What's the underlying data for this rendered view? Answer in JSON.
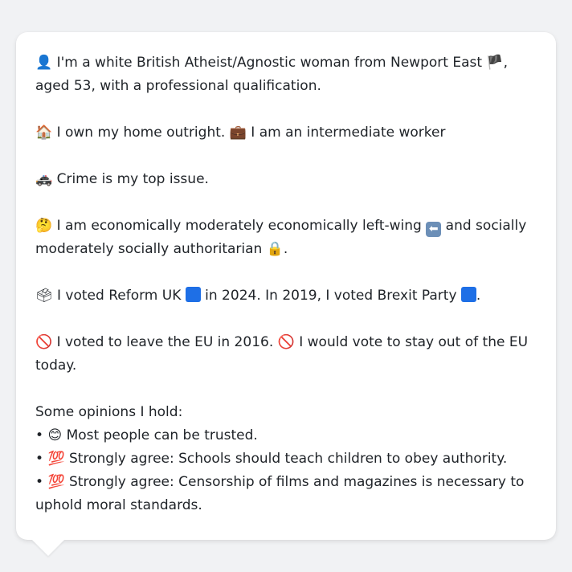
{
  "persona": {
    "intro": {
      "emoji": "👤",
      "text_a": "I'm a white British Atheist/Agnostic woman from Newport East",
      "flag_emoji": "🏴",
      "text_b": ", aged 53, with a professional qualification."
    },
    "home": {
      "emoji_house": "🏠",
      "text_a": "I own my home outright.",
      "emoji_briefcase": "💼",
      "text_b": "I am an intermediate worker"
    },
    "issue": {
      "emoji": "🚓",
      "text": "Crime is my top issue."
    },
    "politics": {
      "emoji_think": "🤔",
      "text_a": "I am economically moderately economically left-wing",
      "emoji_left": "⬅",
      "text_b": "and socially moderately socially authoritarian",
      "emoji_lock": "🔒",
      "text_c": "."
    },
    "vote": {
      "emoji_ballot": "🗳",
      "text_a": "I voted Reform UK",
      "text_b": "in 2024. In 2019, I voted Brexit Party",
      "text_c": "."
    },
    "eu": {
      "emoji_no": "🚫",
      "text_a": "I voted to leave the EU in 2016.",
      "text_b": "I would vote to stay out of the EU today."
    },
    "opinions": {
      "heading": "Some opinions I hold:",
      "bullet": "•",
      "items": [
        {
          "emoji": "😊",
          "text": "Most people can be trusted."
        },
        {
          "emoji": "💯",
          "text": "Strongly agree: Schools should teach children to obey authority."
        },
        {
          "emoji": "💯",
          "text": "Strongly agree: Censorship of films and magazines is necessary to uphold moral standards."
        }
      ]
    }
  },
  "colors": {
    "background": "#f1f2f4",
    "card": "#ffffff",
    "text": "#1f2328",
    "party_square": "#1e6fe6"
  }
}
